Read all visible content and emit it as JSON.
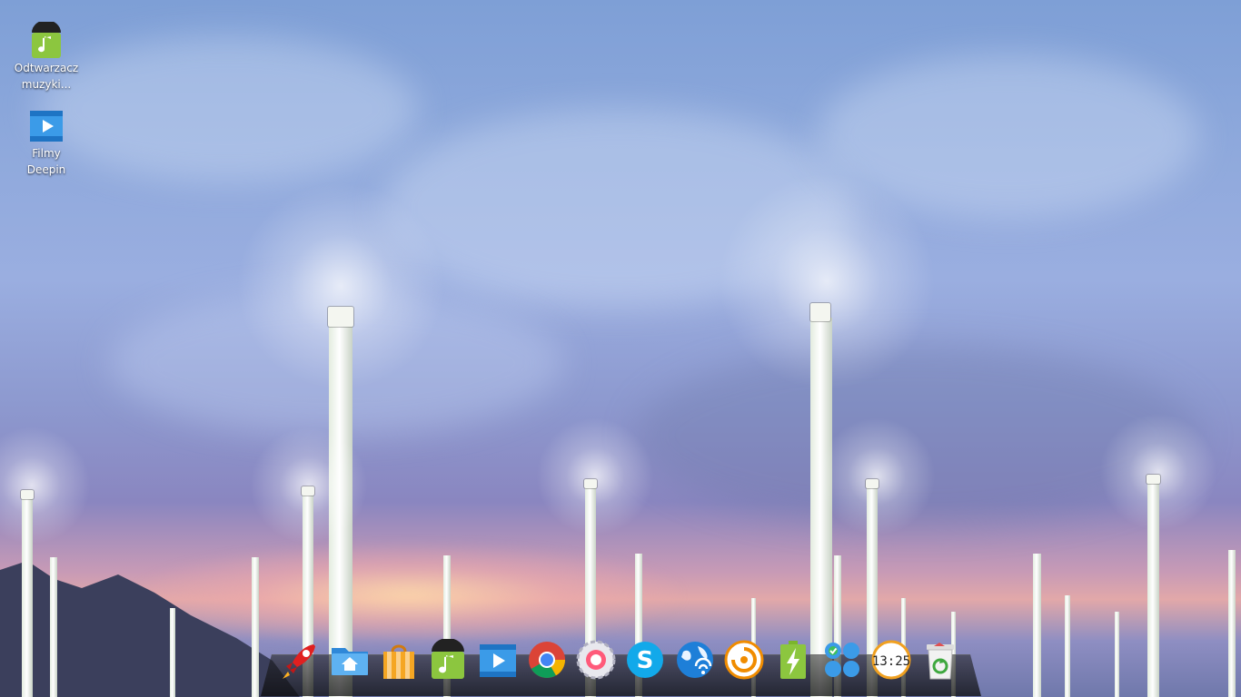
{
  "desktop": {
    "icons": [
      {
        "name": "music-player",
        "label": "Odtwarzacz\nmuzyki...",
        "icon": "music-note-icon"
      },
      {
        "name": "deepin-movie",
        "label": "Filmy\nDeepin",
        "icon": "video-player-icon"
      }
    ]
  },
  "dock": {
    "items": [
      {
        "name": "launcher",
        "icon": "rocket-icon"
      },
      {
        "name": "file-manager",
        "icon": "home-folder-icon"
      },
      {
        "name": "software-store",
        "icon": "shopping-bag-icon"
      },
      {
        "name": "music-player",
        "icon": "music-note-icon"
      },
      {
        "name": "movie-player",
        "icon": "video-player-icon"
      },
      {
        "name": "chrome",
        "icon": "chrome-icon"
      },
      {
        "name": "system-settings",
        "icon": "gear-icon"
      },
      {
        "name": "skype",
        "icon": "skype-icon"
      },
      {
        "name": "network",
        "icon": "globe-wifi-icon"
      },
      {
        "name": "update",
        "icon": "refresh-icon"
      },
      {
        "name": "power",
        "icon": "battery-icon"
      },
      {
        "name": "applets",
        "icon": "grid-icon"
      },
      {
        "name": "clock",
        "icon": "clock-icon"
      },
      {
        "name": "trash",
        "icon": "trash-icon"
      }
    ],
    "clock_text": "13:25"
  },
  "colors": {
    "music_green": "#8cc63f",
    "movie_blue": "#3b9be8",
    "dock_bg": "#1a1a1a"
  }
}
